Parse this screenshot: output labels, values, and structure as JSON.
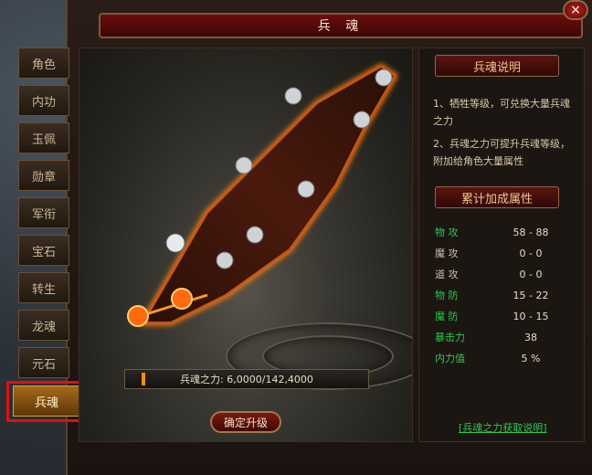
{
  "window": {
    "title": "兵 魂",
    "close": "×"
  },
  "tabs": [
    {
      "label": "角色"
    },
    {
      "label": "内功"
    },
    {
      "label": "玉佩"
    },
    {
      "label": "勋章"
    },
    {
      "label": "军衔"
    },
    {
      "label": "宝石"
    },
    {
      "label": "转生"
    },
    {
      "label": "龙魂"
    },
    {
      "label": "元石"
    },
    {
      "label": "兵魂",
      "active": true
    }
  ],
  "power": {
    "label": "兵魂之力: 6,0000/142,4000",
    "current": 60000,
    "max": 1424000
  },
  "upgrade_button": "确定升级",
  "desc_section": {
    "title": "兵魂说明",
    "lines": [
      "1、牺牲等级，可兑换大量兵魂之力",
      "2、兵魂之力可提升兵魂等级，附加给角色大量属性"
    ]
  },
  "stats_section": {
    "title": "累计加成属性",
    "rows": [
      {
        "label": "物  攻",
        "value": "58 - 88",
        "color": "#2fc84a"
      },
      {
        "label": "魔  攻",
        "value": "0 - 0",
        "color": "#c9c0ad"
      },
      {
        "label": "道  攻",
        "value": "0 - 0",
        "color": "#c9c0ad"
      },
      {
        "label": "物  防",
        "value": "15 - 22",
        "color": "#2fc84a"
      },
      {
        "label": "魔  防",
        "value": "10 - 15",
        "color": "#2fc84a"
      },
      {
        "label": "暴击力",
        "value": "38",
        "color": "#2fc84a"
      },
      {
        "label": "内力值",
        "value": "5 %",
        "color": "#2fc84a"
      }
    ]
  },
  "help_link": "[兵魂之力获取说明]",
  "colors": {
    "accent": "#ff8a1c",
    "frame": "#6b0d0d",
    "stat_green": "#2fc84a"
  }
}
